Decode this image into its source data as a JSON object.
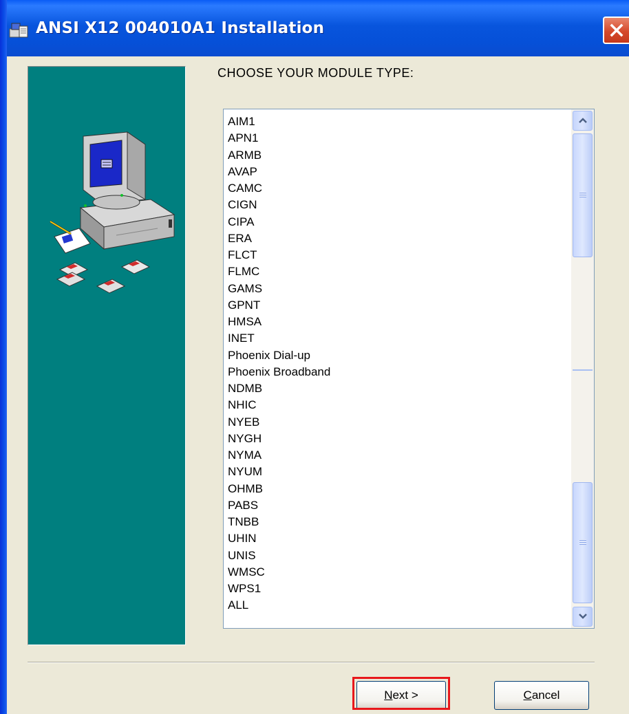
{
  "window": {
    "title": "ANSI X12 004010A1 Installation",
    "title_icon": "installer-icon",
    "close_icon": "close-icon"
  },
  "banner": {
    "illustration": "computer-setup-illustration"
  },
  "prompt": "CHOOSE YOUR MODULE TYPE:",
  "module_list": {
    "items": [
      "AIM1",
      "APN1",
      "ARMB",
      "AVAP",
      "CAMC",
      "CIGN",
      "CIPA",
      "ERA",
      "FLCT",
      "FLMC",
      "GAMS",
      "GPNT",
      "HMSA",
      "INET",
      "Phoenix Dial-up",
      "Phoenix Broadband",
      "NDMB",
      "NHIC",
      "NYEB",
      "NYGH",
      "NYMA",
      "NYUM",
      "OHMB",
      "PABS",
      "TNBB",
      "UHIN",
      "UNIS",
      "WMSC",
      "WPS1",
      "ALL"
    ]
  },
  "buttons": {
    "next_mnemonic": "N",
    "next_rest": "ext >",
    "cancel_mnemonic": "C",
    "cancel_rest": "ancel"
  },
  "colors": {
    "title_bar": "#0855dd",
    "banner": "#007f7f",
    "dialog_bg": "#ece9d8",
    "highlight": "#e8171b"
  }
}
